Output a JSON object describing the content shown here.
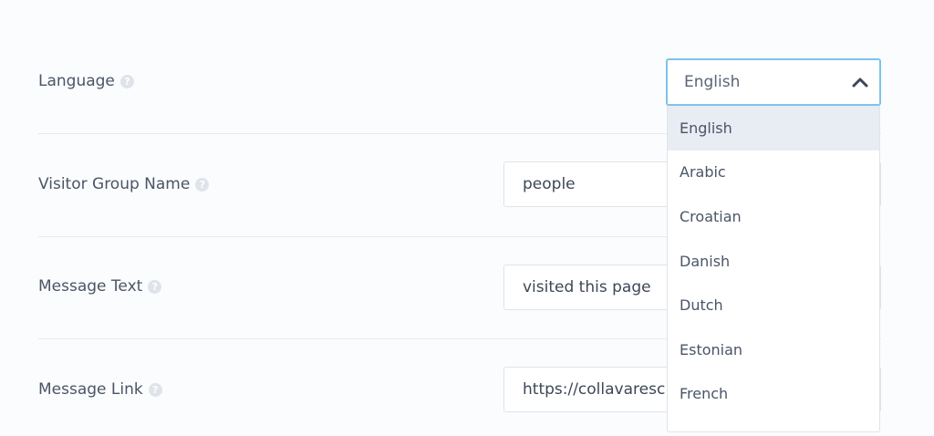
{
  "form": {
    "language": {
      "label": "Language",
      "value": "English"
    },
    "visitor_group": {
      "label": "Visitor Group Name",
      "value": "people"
    },
    "message_text": {
      "label": "Message Text",
      "value": "visited this page"
    },
    "message_link": {
      "label": "Message Link",
      "value": "https://collavaresc"
    }
  },
  "dropdown": {
    "options": [
      "English",
      "Arabic",
      "Croatian",
      "Danish",
      "Dutch",
      "Estonian",
      "French"
    ],
    "selected_index": 0
  },
  "help_glyph": "?",
  "colors": {
    "focus_border": "#7cc4ea",
    "selected_bg": "#e8ecf3",
    "text": "#4a5567"
  }
}
